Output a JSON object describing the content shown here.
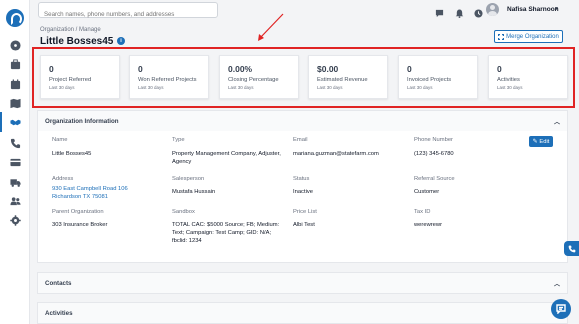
{
  "search": {
    "placeholder": "Search names, phone numbers, and addresses"
  },
  "user": {
    "name": "Nafisa Sharnoon"
  },
  "breadcrumb": "Organization / Manage",
  "page_title": "Little Bosses45",
  "merge_button": "Merge Organization",
  "stats": [
    {
      "value": "0",
      "label": "Project Referred",
      "sub": "Last 30 days"
    },
    {
      "value": "0",
      "label": "Won Referred Projects",
      "sub": "Last 30 days"
    },
    {
      "value": "0.00%",
      "label": "Closing Percentage",
      "sub": "Last 30 days"
    },
    {
      "value": "$0.00",
      "label": "Estimated Revenue",
      "sub": "Last 30 days"
    },
    {
      "value": "0",
      "label": "Invoiced Projects",
      "sub": "Last 30 days"
    },
    {
      "value": "0",
      "label": "Activities",
      "sub": "Last 30 days"
    }
  ],
  "org_info": {
    "title": "Organization Information",
    "edit_label": "Edit",
    "name_label": "Name",
    "name": "Little Bosses45",
    "type_label": "Type",
    "type": "Property Management Company, Adjuster, Agency",
    "email_label": "Email",
    "email": "mariana.guzman@statefarm.com",
    "phone_label": "Phone Number",
    "phone": "(123) 345-6780",
    "address_label": "Address",
    "address_line1": "930 East Campbell Road 106",
    "address_line2": "Richardson TX 75081",
    "salesperson_label": "Salesperson",
    "salesperson": "Mustafa Hussain",
    "status_label": "Status",
    "status": "Inactive",
    "referral_label": "Referral Source",
    "referral": "Customer",
    "parent_label": "Parent Organization",
    "parent": "303 Insurance Broker",
    "sandbox_label": "Sandbox",
    "sandbox": "TOTAL CAC: $5000 Source; FB; Medium: Text; Campaign: Test Camp; GID: N/A; fbclid: 1234",
    "pricelist_label": "Price List",
    "pricelist": "Albi Test",
    "taxid_label": "Tax ID",
    "taxid": "werewrewr"
  },
  "contacts": {
    "title": "Contacts"
  },
  "activities": {
    "title": "Activities"
  },
  "colors": {
    "accent": "#1d6fb8",
    "highlight": "#e02424"
  }
}
